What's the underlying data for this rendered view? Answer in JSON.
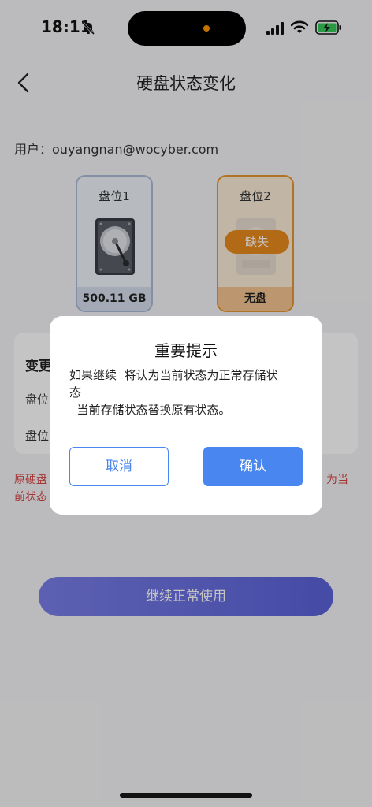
{
  "status_bar": {
    "time": "18:11",
    "icons": [
      "bell-off-icon",
      "signal-icon",
      "wifi-icon",
      "battery-charging-icon"
    ],
    "island_dot_color": "#ff9500"
  },
  "header": {
    "title": "硬盘状态变化",
    "back_icon": "chevron-left-icon"
  },
  "user": {
    "label": "用户：",
    "email": "ouyangnan@wocyber.com"
  },
  "slots": [
    {
      "label": "盘位1",
      "footer": "500.11 GB",
      "icon": "hard-drive-icon",
      "border_color": "#a9bbd6"
    },
    {
      "label": "盘位2",
      "footer": "无盘",
      "icon": "hard-drive-icon",
      "badge": "缺失",
      "border_color": "#e7962f",
      "badge_color": "#e88a1e"
    }
  ],
  "change_card": {
    "title": "变更",
    "rows": [
      "盘位",
      "盘位"
    ]
  },
  "warning": {
    "line1": "原硬盘",
    "line2": "前状态",
    "right": "为当"
  },
  "continue_button": {
    "label": "继续正常使用",
    "color": "#5a62d8"
  },
  "dialog": {
    "title": "重要提示",
    "message_lines": [
      "如果继续  将认为当前状态为正常存储状",
      "态",
      "  当前存储状态替换原有状态。"
    ],
    "cancel_label": "取消",
    "confirm_label": "确认",
    "accent_color": "#4a86f0"
  }
}
